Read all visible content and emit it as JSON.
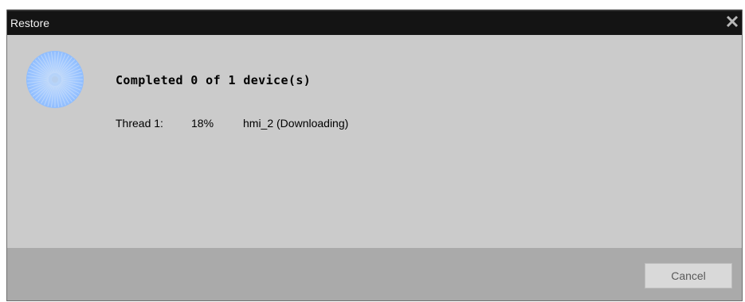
{
  "window": {
    "title": "Restore",
    "close_icon": "close-icon"
  },
  "status": {
    "title": "Completed 0 of 1 device(s)",
    "spinner_icon": "progress-spinner-icon"
  },
  "threads": [
    {
      "label": "Thread 1:",
      "percent": "18%",
      "detail": "hmi_2 (Downloading)"
    }
  ],
  "footer": {
    "cancel_label": "Cancel"
  },
  "colors": {
    "titlebar": "#141414",
    "body": "#cbcbcb",
    "footer": "#aaaaaa",
    "spinner": "#9ec8ff"
  }
}
